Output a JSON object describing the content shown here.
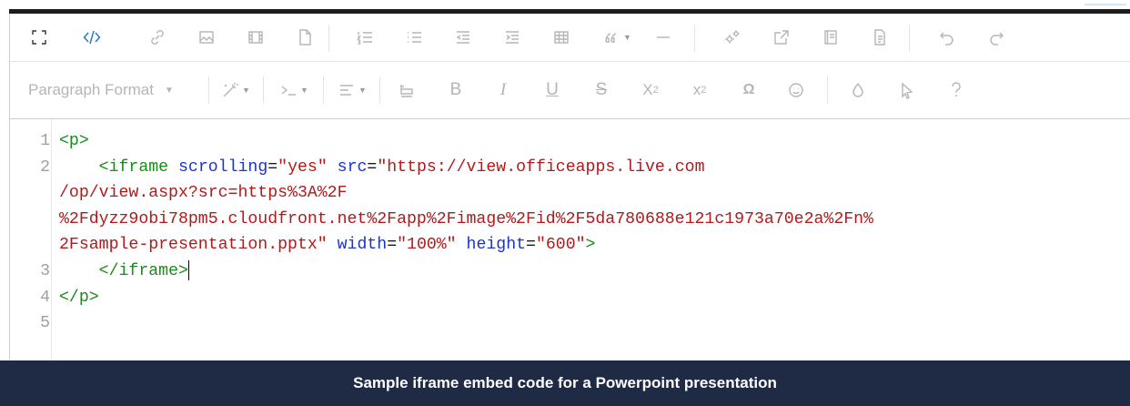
{
  "toolbar_row1": {
    "icons": [
      "fullscreen-icon",
      "code-view-icon",
      "link-icon",
      "image-icon",
      "video-icon",
      "file-icon",
      "ordered-list-icon",
      "unordered-list-icon",
      "outdent-icon",
      "indent-icon",
      "table-icon",
      "quote-icon",
      "horizontal-line-icon",
      "settings-icon",
      "external-link-icon",
      "template-icon",
      "document-icon",
      "undo-icon",
      "redo-icon"
    ],
    "active": "code-view-icon"
  },
  "toolbar_row2": {
    "paragraph_format_label": "Paragraph Format",
    "bold": "B",
    "italic": "I",
    "underline": "U",
    "strikethrough": "S",
    "subscript": "X",
    "subscript_sub": "2",
    "superscript": "x",
    "superscript_sup": "2",
    "special_char": "Ω"
  },
  "code_lines": [
    {
      "num": "1",
      "parts": [
        {
          "t": "tag",
          "v": "<p>"
        }
      ]
    },
    {
      "num": "2",
      "parts": [
        {
          "t": "punc",
          "v": "    "
        },
        {
          "t": "tag",
          "v": "<iframe"
        },
        {
          "t": "punc",
          "v": " "
        },
        {
          "t": "attr",
          "v": "scrolling"
        },
        {
          "t": "punc",
          "v": "="
        },
        {
          "t": "str",
          "v": "\"yes\""
        },
        {
          "t": "punc",
          "v": " "
        },
        {
          "t": "attr",
          "v": "src"
        },
        {
          "t": "punc",
          "v": "="
        },
        {
          "t": "str",
          "v": "\"https://view.officeapps.live.com"
        }
      ]
    },
    {
      "num": "",
      "parts": [
        {
          "t": "str",
          "v": "/op/view.aspx?src=https%3A%2F"
        }
      ]
    },
    {
      "num": "",
      "parts": [
        {
          "t": "str",
          "v": "%2Fdyzz9obi78pm5.cloudfront.net%2Fapp%2Fimage%2Fid%2F5da780688e121c1973a70e2a%2Fn%"
        }
      ]
    },
    {
      "num": "",
      "parts": [
        {
          "t": "str",
          "v": "2Fsample-presentation.pptx\""
        },
        {
          "t": "punc",
          "v": " "
        },
        {
          "t": "attr",
          "v": "width"
        },
        {
          "t": "punc",
          "v": "="
        },
        {
          "t": "str",
          "v": "\"100%\""
        },
        {
          "t": "punc",
          "v": " "
        },
        {
          "t": "attr",
          "v": "height"
        },
        {
          "t": "punc",
          "v": "="
        },
        {
          "t": "str",
          "v": "\"600\""
        },
        {
          "t": "tag",
          "v": ">"
        }
      ]
    },
    {
      "num": "3",
      "parts": [
        {
          "t": "punc",
          "v": "    "
        },
        {
          "t": "tag",
          "v": "</iframe>"
        }
      ],
      "cursor": true
    },
    {
      "num": "4",
      "parts": [
        {
          "t": "tag",
          "v": "</p>"
        }
      ]
    },
    {
      "num": "5",
      "parts": []
    }
  ],
  "caption": "Sample iframe embed code for a Powerpoint presentation",
  "colors": {
    "tag": "#1a8a1a",
    "attr": "#1a36c9",
    "string": "#b11a1a",
    "active": "#1e74d6",
    "caption_bg": "#1f2a44"
  }
}
